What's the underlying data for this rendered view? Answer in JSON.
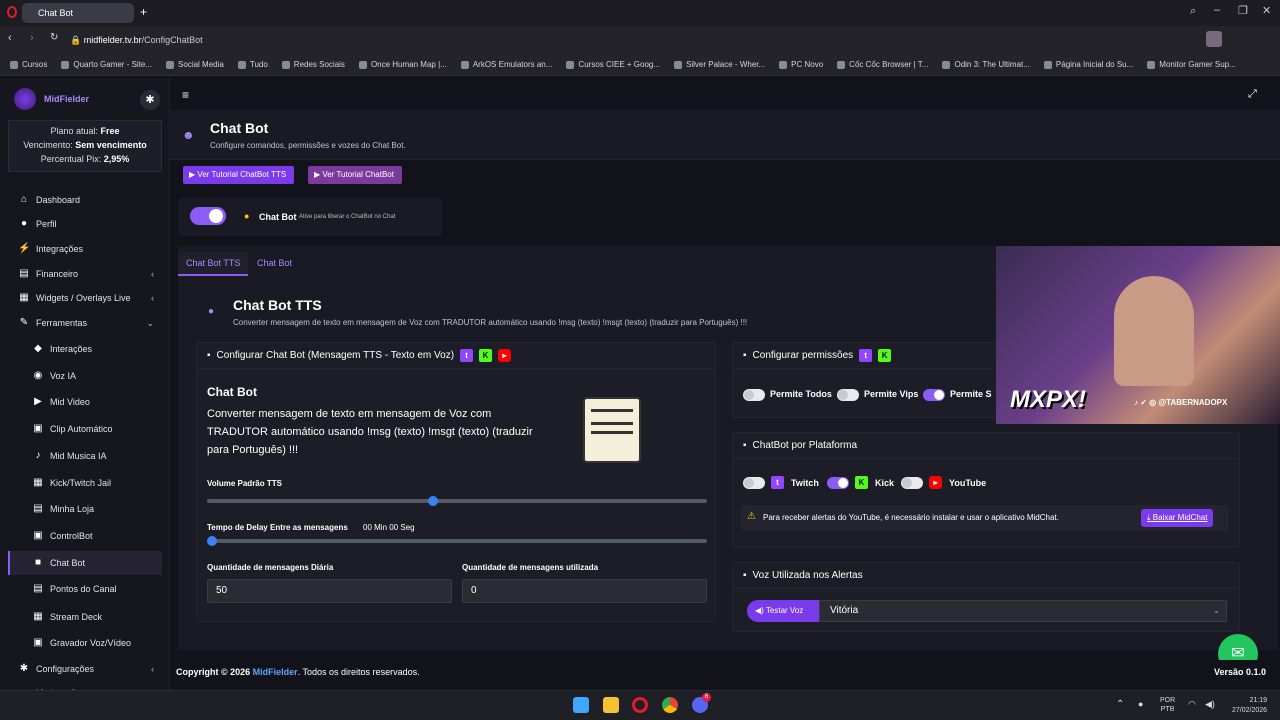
{
  "browser": {
    "tab_title": "Chat Bot",
    "url_host": "midfielder.tv.br",
    "url_path": "/ConfigChatBot",
    "bookmarks": [
      "Cursos",
      "Quarto Gamer - Site...",
      "Social Media",
      "Tudo",
      "Redes Sociais",
      "Once Human Map |...",
      "ArkOS Emulators an...",
      "Cursos CIEE + Goog...",
      "Silver Palace - Wher...",
      "PC Novo",
      "Cốc Cốc Browser | T...",
      "Odin 3: The Ultimat...",
      "Página Inicial do Su...",
      "Monitor Gamer Sup..."
    ]
  },
  "sidebar": {
    "brand": "MidFielder",
    "plan_label": "Plano atual:",
    "plan_value": "Free",
    "expiry_label": "Vencimento:",
    "expiry_value": "Sem vencimento",
    "pix_label": "Percentual Pix:",
    "pix_value": "2,95%",
    "items": [
      {
        "label": "Dashboard",
        "icon": "dashboard-icon"
      },
      {
        "label": "Perfil",
        "icon": "user-icon"
      },
      {
        "label": "Integrações",
        "icon": "plug-icon"
      },
      {
        "label": "Financeiro",
        "icon": "wallet-icon"
      },
      {
        "label": "Widgets / Overlays Live",
        "icon": "layers-icon"
      },
      {
        "label": "Ferramentas",
        "icon": "tools-icon"
      },
      {
        "label": "Interações",
        "icon": "interactions-icon"
      },
      {
        "label": "Voz IA",
        "icon": "voice-icon"
      },
      {
        "label": "Mid Video",
        "icon": "video-icon"
      },
      {
        "label": "Clip Automático",
        "icon": "clip-icon"
      },
      {
        "label": "Mid Musica IA",
        "icon": "music-icon"
      },
      {
        "label": "Kick/Twitch Jail",
        "icon": "jail-icon"
      },
      {
        "label": "Minha Loja",
        "icon": "store-icon"
      },
      {
        "label": "ControlBot",
        "icon": "controlbot-icon"
      },
      {
        "label": "Chat Bot",
        "icon": "chat-icon"
      },
      {
        "label": "Pontos do Canal",
        "icon": "coins-icon"
      },
      {
        "label": "Stream Deck",
        "icon": "keyboard-icon"
      },
      {
        "label": "Gravador Voz/Vídeo",
        "icon": "recorder-icon"
      },
      {
        "label": "Configurações",
        "icon": "settings-icon"
      },
      {
        "label": "Moderação",
        "icon": "shield-icon"
      }
    ]
  },
  "header": {
    "title": "Chat Bot",
    "subtitle": "Configure comandos, permissões e vozes do Chat Bot.",
    "btn_tutorial_tts": "Ver Tutorial ChatBot TTS",
    "btn_tutorial": "Ver Tutorial ChatBot"
  },
  "toggle_card": {
    "label": "Chat Bot",
    "hint": "Ative para liberar o ChatBot no Chat"
  },
  "tabs": [
    "Chat Bot TTS",
    "Chat Bot"
  ],
  "section": {
    "title": "Chat Bot TTS",
    "subtitle": "Converter mensagem de texto em mensagem de Voz com TRADUTOR automático usando !msg (texto) !msgt (texto) (traduzir para Português) !!!"
  },
  "config_card": {
    "header": "Configurar Chat Bot (Mensagem TTS - Texto em Voz)",
    "title": "Chat Bot",
    "description": "Converter mensagem de texto em mensagem de Voz com TRADUTOR automático usando !msg (texto) !msgt (texto) (traduzir para Português) !!!",
    "volume_label": "Volume Padrão TTS",
    "volume_level": 0.45,
    "delay_label": "Tempo de Delay Entre as mensagens",
    "delay_value": "00 Min 00 Seg",
    "delay_level": 0,
    "daily_label": "Quantidade de mensagens Diária",
    "daily_value": "50",
    "used_label": "Quantidade de mensagens utilizada",
    "used_value": "0"
  },
  "permissions": {
    "header": "Configurar permissões",
    "items": [
      {
        "label": "Permite Todos",
        "on": false
      },
      {
        "label": "Permite Vips",
        "on": false
      },
      {
        "label": "Permite S",
        "on": true
      }
    ]
  },
  "platform": {
    "header": "ChatBot por Plataforma",
    "items": [
      {
        "label": "Twitch",
        "on": false
      },
      {
        "label": "Kick",
        "on": true
      },
      {
        "label": "YouTube",
        "on": false
      }
    ],
    "alert": "Para receber alertas do YouTube, é necessário instalar e usar o aplicativo MidChat.",
    "download_btn": "Baixar MidChat"
  },
  "voice": {
    "header": "Voz Utilizada nos Alertas",
    "test_btn": "Testar Voz",
    "selected": "Vitória"
  },
  "footer": {
    "copyright": "Copyright © 2026",
    "brand": "MidFielder",
    "rest": ". Todos os direitos reservados.",
    "version": "Versão 0.1.0"
  },
  "overlay": {
    "logo": "MXPX!",
    "handle": "@TABERNADOPX"
  },
  "taskbar": {
    "lang": "POR",
    "layout": "PTB",
    "time": "21:19",
    "date": "27/02/2026",
    "notif": "6"
  },
  "colors": {
    "accent": "#8b5cf6",
    "bg": "#12121a",
    "card": "#1d1d28"
  }
}
